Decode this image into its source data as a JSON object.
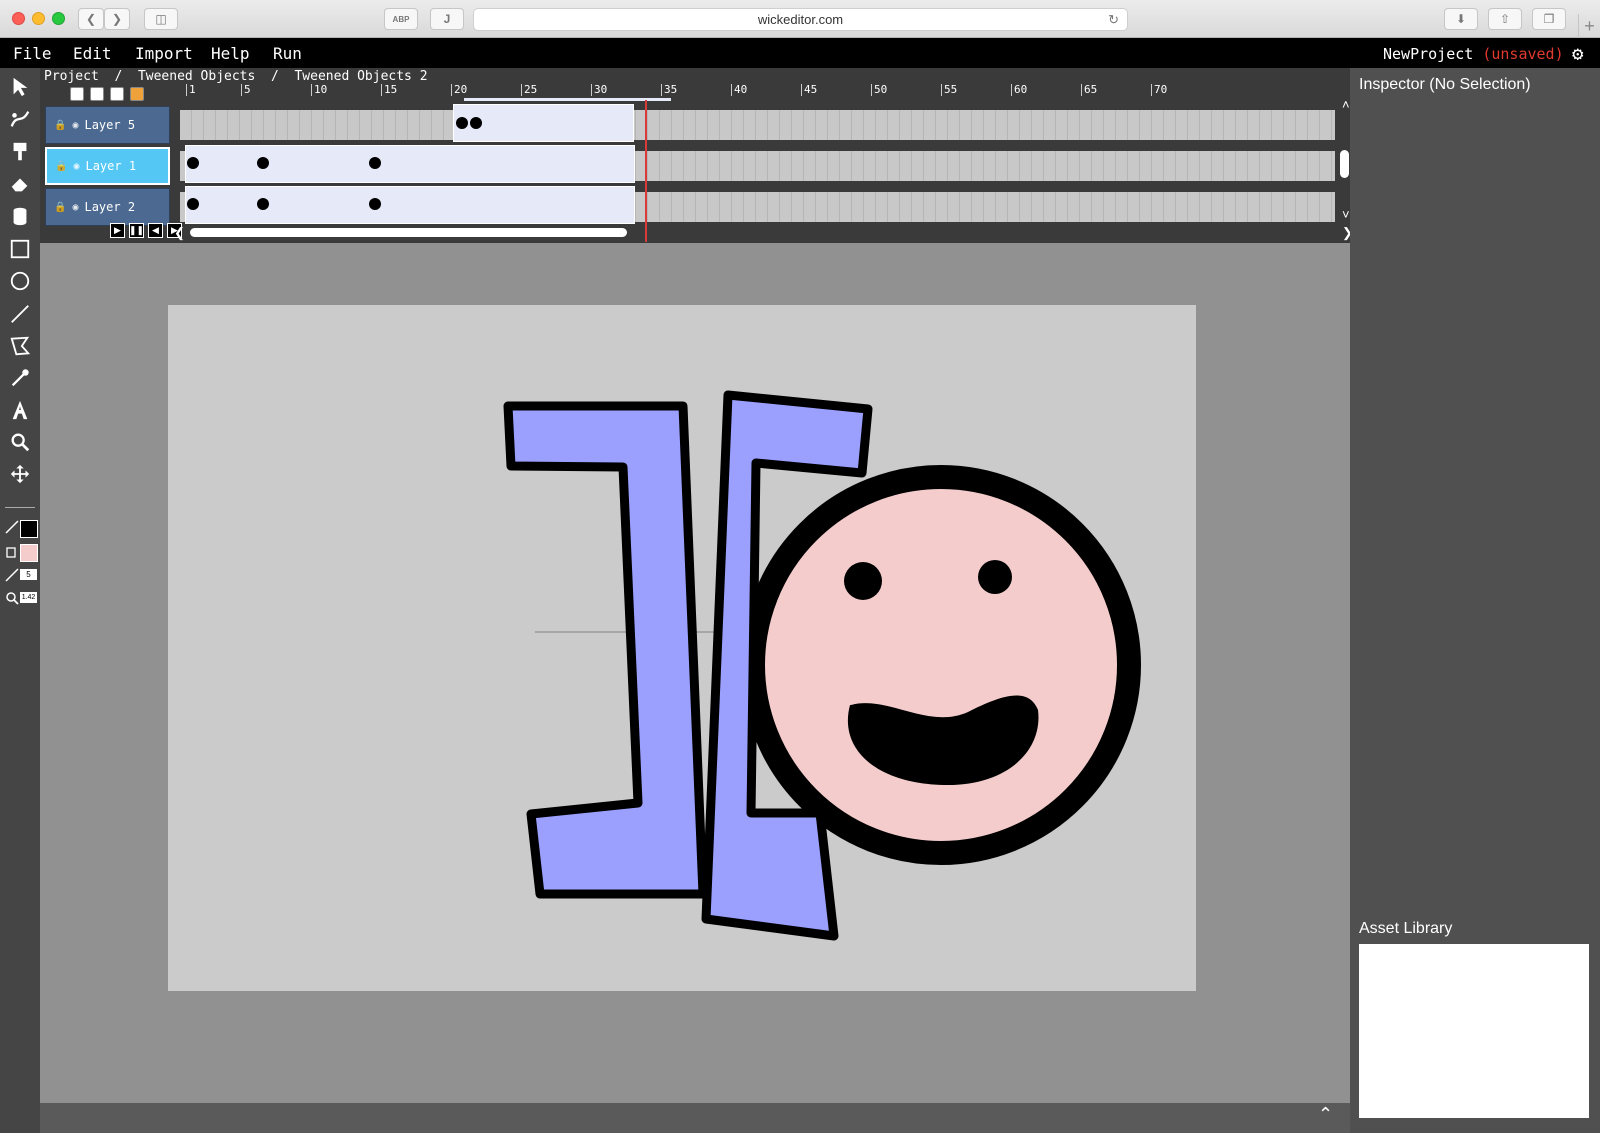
{
  "browser": {
    "url": "wickeditor.com",
    "adblock_label": "ABP",
    "ext_label": "J"
  },
  "menubar": {
    "items": [
      "File",
      "Edit",
      "Import",
      "Help",
      "Run"
    ],
    "project_name": "NewProject",
    "unsaved_label": "(unsaved)"
  },
  "breadcrumb": {
    "items": [
      "Project",
      "Tweened Objects",
      "Tweened Objects 2"
    ],
    "separator": "/"
  },
  "timeline": {
    "ruler_ticks": [
      "1",
      "5",
      "10",
      "15",
      "20",
      "25",
      "30",
      "35",
      "40",
      "45",
      "50",
      "55",
      "60",
      "65",
      "70"
    ],
    "layers": [
      {
        "name": "Layer 5",
        "active": false
      },
      {
        "name": "Layer 1",
        "active": true
      },
      {
        "name": "Layer 2",
        "active": false
      }
    ],
    "playhead_frame": 30
  },
  "toolbar": {
    "stroke_width": "5",
    "zoom": "1.42",
    "stroke_color": "#000000",
    "fill_color": "#f4cccc"
  },
  "inspector": {
    "title": "Inspector (No Selection)"
  },
  "asset_library": {
    "title": "Asset Library"
  },
  "colors": {
    "shape_fill": "#9ba0ff",
    "face_fill": "#f4cccc",
    "stroke": "#000000",
    "active_layer": "#55c7f5",
    "playhead": "#d93b3b",
    "unsaved": "#e0392e"
  }
}
